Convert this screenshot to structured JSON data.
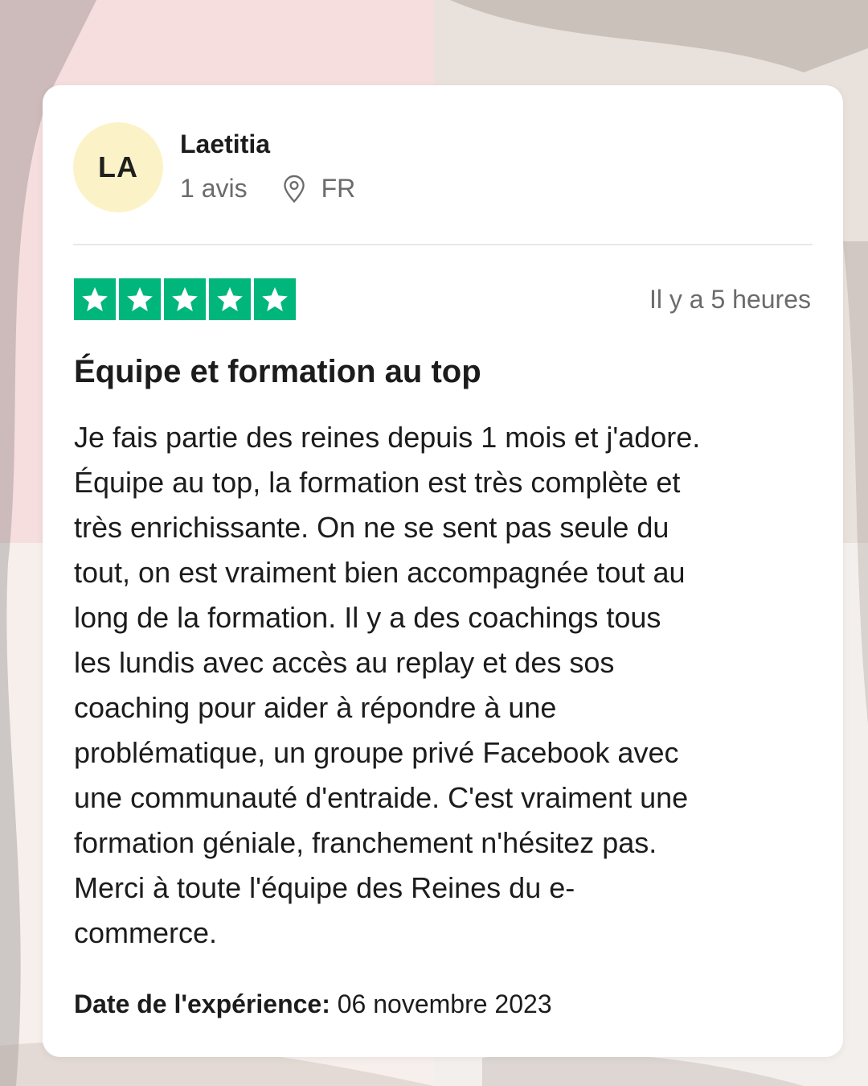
{
  "reviewer": {
    "initials": "LA",
    "name": "Laetitia",
    "reviews_count": "1 avis",
    "country": "FR"
  },
  "review": {
    "rating": 5,
    "relative_date": "Il y a 5 heures",
    "title": "Équipe et formation au top",
    "body_lines": [
      "Je fais partie des reines depuis 1 mois et j'adore.",
      "Équipe au top, la formation est très complète et",
      "très enrichissante. On ne se sent pas seule du",
      "tout, on est vraiment bien accompagnée tout au",
      "long de la formation. Il y a des coachings tous",
      "les lundis avec accès au replay et des sos",
      "coaching pour aider à répondre à une",
      "problématique, un groupe privé Facebook avec",
      "une communauté d'entraide. C'est vraiment une",
      "formation géniale, franchement n'hésitez pas.",
      "Merci à toute l'équipe des Reines du e-",
      "commerce."
    ],
    "experience_label": "Date de l'expérience:",
    "experience_date": "06 novembre 2023"
  },
  "icons": {
    "location": "location-pin-icon",
    "star": "star-icon"
  },
  "colors": {
    "star_green": "#00b67a",
    "avatar_bg": "#fbf3c7",
    "meta_gray": "#6b6b6b"
  }
}
